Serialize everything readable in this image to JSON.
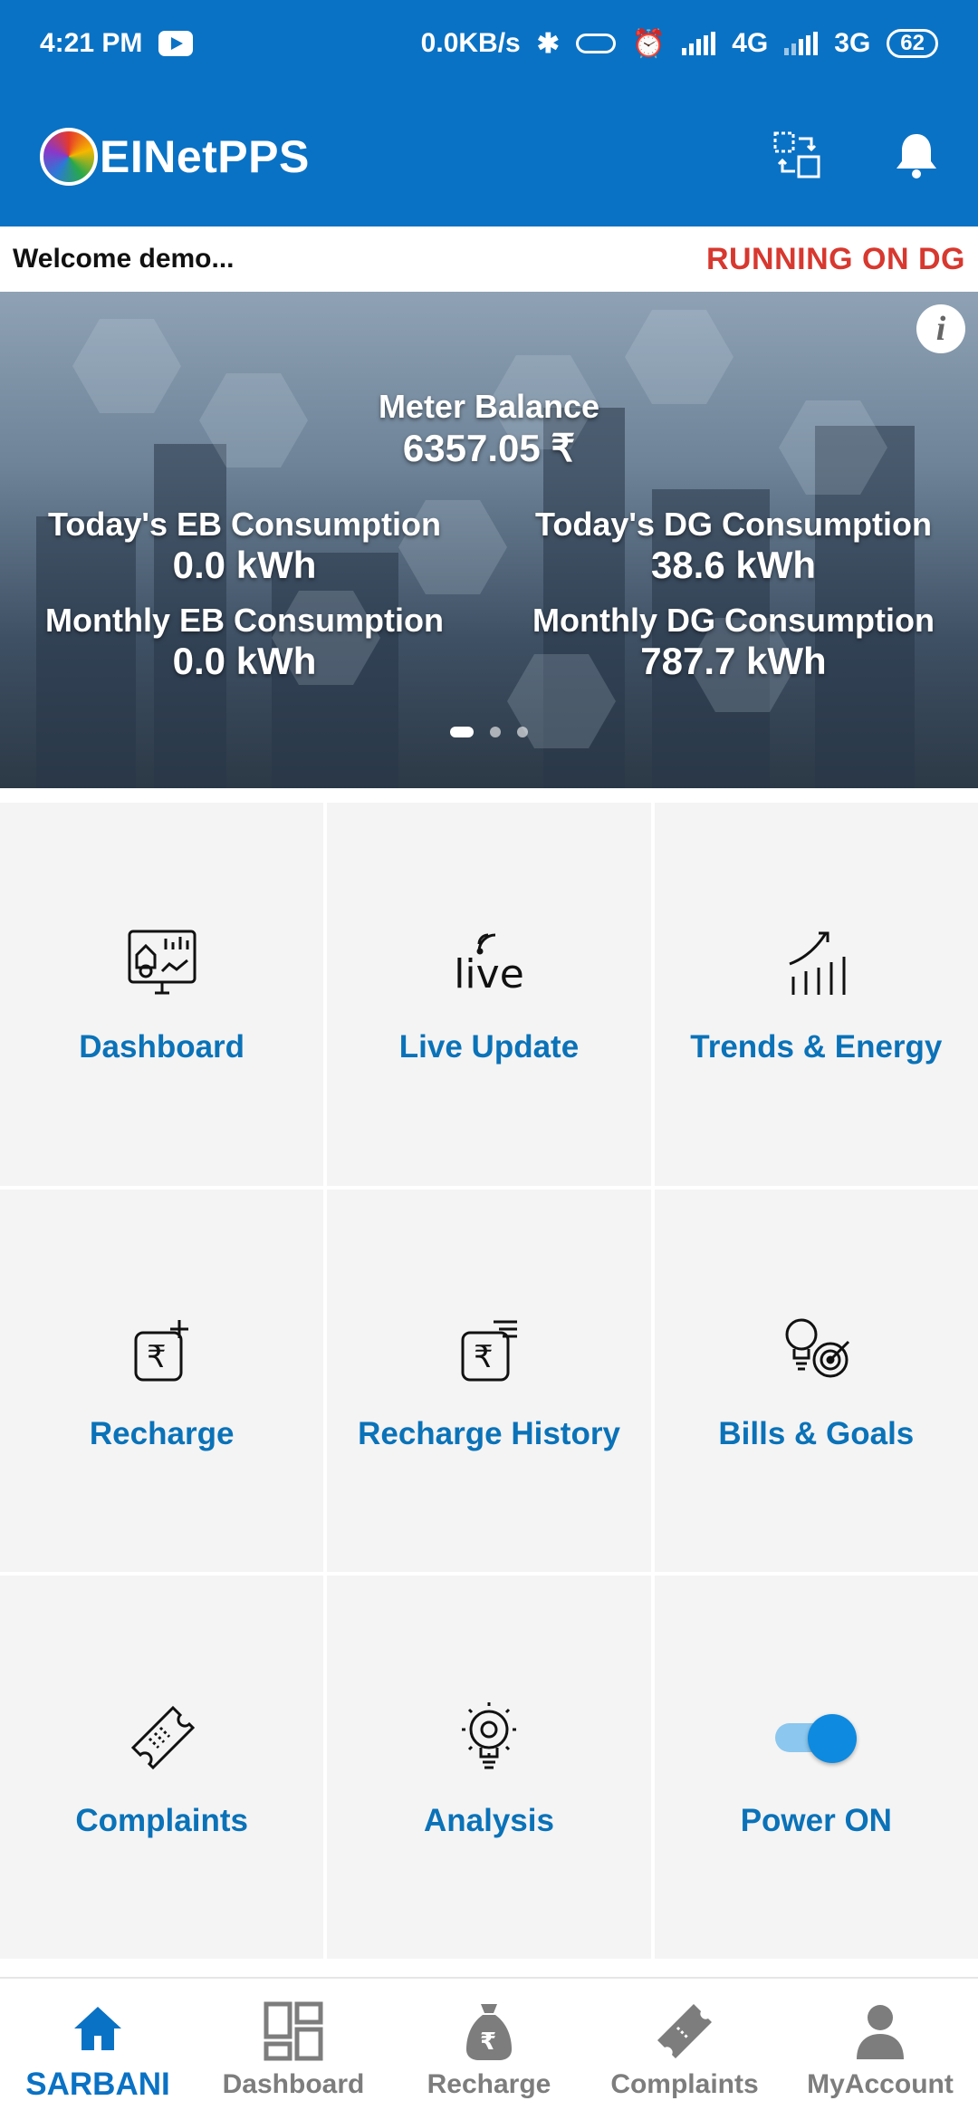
{
  "status_bar": {
    "time": "4:21 PM",
    "net_speed": "0.0KB/s",
    "network_1": "4G",
    "network_2": "3G",
    "battery": "62"
  },
  "app_bar": {
    "title": "EINetPPS"
  },
  "welcome": {
    "text": "Welcome demo...",
    "status": "RUNNING ON DG"
  },
  "banner": {
    "meter_balance_label": "Meter Balance",
    "meter_balance_value": "6357.05 ₹",
    "todays_eb_label": "Today's EB Consumption",
    "todays_eb_value": "0.0 kWh",
    "todays_dg_label": "Today's DG Consumption",
    "todays_dg_value": "38.6 kWh",
    "monthly_eb_label": "Monthly EB Consumption",
    "monthly_eb_value": "0.0 kWh",
    "monthly_dg_label": "Monthly DG Consumption",
    "monthly_dg_value": "787.7 kWh",
    "info_glyph": "i",
    "page_count": 3,
    "active_page": 1
  },
  "tiles": [
    {
      "label": "Dashboard",
      "icon": "dashboard-monitor-icon"
    },
    {
      "label": "Live Update",
      "icon": "live-icon",
      "icon_text": "live"
    },
    {
      "label": "Trends & Energy",
      "icon": "trend-chart-icon"
    },
    {
      "label": "Recharge",
      "icon": "rupee-add-icon"
    },
    {
      "label": "Recharge History",
      "icon": "rupee-history-icon"
    },
    {
      "label": "Bills & Goals",
      "icon": "bulb-target-icon"
    },
    {
      "label": "Complaints",
      "icon": "ticket-icon"
    },
    {
      "label": "Analysis",
      "icon": "bulb-gear-icon"
    },
    {
      "label": "Power ON",
      "icon": "toggle-on-icon",
      "toggle_on": true
    }
  ],
  "bottom_nav": [
    {
      "label": "SARBANI",
      "icon": "home-icon",
      "active": true
    },
    {
      "label": "Dashboard",
      "icon": "dashboard-icon",
      "active": false
    },
    {
      "label": "Recharge",
      "icon": "money-bag-icon",
      "active": false
    },
    {
      "label": "Complaints",
      "icon": "ticket-icon",
      "active": false
    },
    {
      "label": "MyAccount",
      "icon": "person-icon",
      "active": false
    }
  ],
  "colors": {
    "primary": "#0a72c4",
    "tile_label": "#0a72b8",
    "alert": "#d7382f",
    "tile_bg": "#f4f4f4",
    "nav_inactive": "#7d7d7d"
  }
}
